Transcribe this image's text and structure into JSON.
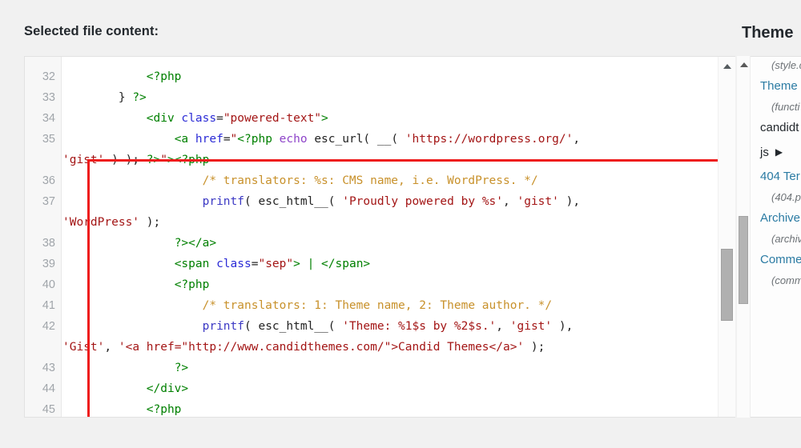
{
  "header": {
    "label": "Selected file content:"
  },
  "theme_panel": {
    "title": "Theme",
    "items": [
      {
        "type": "sub",
        "text": "(style.c"
      },
      {
        "type": "link",
        "text": "Theme "
      },
      {
        "type": "sub",
        "text": "(functi"
      },
      {
        "type": "plain",
        "text": "candidt"
      },
      {
        "type": "folder",
        "text": "js",
        "caret": "▶"
      },
      {
        "type": "link",
        "text": "404 Ter"
      },
      {
        "type": "sub",
        "text": "(404.p"
      },
      {
        "type": "link",
        "text": "Archive"
      },
      {
        "type": "sub",
        "text": "(archiv"
      },
      {
        "type": "link",
        "text": "Comme"
      },
      {
        "type": "sub",
        "text": "(comm"
      }
    ],
    "scrollbar": {
      "up_arrow_icon": "triangle-up-icon",
      "thumb_name": "theme-panel-scroll-thumb"
    }
  },
  "editor": {
    "scrollbar": {
      "up_arrow_icon": "triangle-up-icon",
      "thumb_name": "editor-scroll-thumb"
    },
    "annotation": {
      "color": "#ee1c1c",
      "shape": "rectangle",
      "covers_lines": "34-44"
    },
    "lines": [
      {
        "no": "32",
        "tokens": [
          {
            "c": "t-plain",
            "t": "            "
          },
          {
            "c": "t-tag",
            "t": "<?php"
          }
        ]
      },
      {
        "no": "33",
        "tokens": [
          {
            "c": "t-plain",
            "t": "        } "
          },
          {
            "c": "t-tag",
            "t": "?>"
          }
        ]
      },
      {
        "no": "34",
        "tokens": [
          {
            "c": "t-plain",
            "t": "            "
          },
          {
            "c": "t-tag",
            "t": "<div "
          },
          {
            "c": "t-attr",
            "t": "class"
          },
          {
            "c": "t-plain",
            "t": "="
          },
          {
            "c": "t-str",
            "t": "\"powered-text\""
          },
          {
            "c": "t-tag",
            "t": ">"
          }
        ]
      },
      {
        "no": "35",
        "tokens": [
          {
            "c": "t-plain",
            "t": "                "
          },
          {
            "c": "t-tag",
            "t": "<a "
          },
          {
            "c": "t-attr",
            "t": "href"
          },
          {
            "c": "t-plain",
            "t": "="
          },
          {
            "c": "t-str",
            "t": "\""
          },
          {
            "c": "t-tag",
            "t": "<?php "
          },
          {
            "c": "t-kw",
            "t": "echo "
          },
          {
            "c": "t-plain",
            "t": "esc_url( __( "
          },
          {
            "c": "t-str",
            "t": "'https://wordpress.org/'"
          },
          {
            "c": "t-plain",
            "t": ","
          }
        ]
      },
      {
        "no": "",
        "wrap": true,
        "tokens": [
          {
            "c": "t-str",
            "t": "'gist'"
          },
          {
            "c": "t-plain",
            "t": " ) ); "
          },
          {
            "c": "t-tag",
            "t": "?>"
          },
          {
            "c": "t-str",
            "t": "\""
          },
          {
            "c": "t-tag",
            "t": "><?php"
          }
        ]
      },
      {
        "no": "36",
        "tokens": [
          {
            "c": "t-plain",
            "t": "                    "
          },
          {
            "c": "t-cmt",
            "t": "/* translators: %s: CMS name, i.e. WordPress. */"
          }
        ]
      },
      {
        "no": "37",
        "tokens": [
          {
            "c": "t-plain",
            "t": "                    "
          },
          {
            "c": "t-fn",
            "t": "printf"
          },
          {
            "c": "t-plain",
            "t": "( esc_html__( "
          },
          {
            "c": "t-str",
            "t": "'Proudly powered by %s'"
          },
          {
            "c": "t-plain",
            "t": ", "
          },
          {
            "c": "t-str",
            "t": "'gist'"
          },
          {
            "c": "t-plain",
            "t": " ),"
          }
        ]
      },
      {
        "no": "",
        "wrap": true,
        "tokens": [
          {
            "c": "t-str",
            "t": "'WordPress'"
          },
          {
            "c": "t-plain",
            "t": " );"
          }
        ]
      },
      {
        "no": "38",
        "tokens": [
          {
            "c": "t-plain",
            "t": "                "
          },
          {
            "c": "t-tag",
            "t": "?></a>"
          }
        ]
      },
      {
        "no": "39",
        "tokens": [
          {
            "c": "t-plain",
            "t": "                "
          },
          {
            "c": "t-tag",
            "t": "<span "
          },
          {
            "c": "t-attr",
            "t": "class"
          },
          {
            "c": "t-plain",
            "t": "="
          },
          {
            "c": "t-str",
            "t": "\"sep\""
          },
          {
            "c": "t-tag",
            "t": "> | </span>"
          }
        ]
      },
      {
        "no": "40",
        "tokens": [
          {
            "c": "t-plain",
            "t": "                "
          },
          {
            "c": "t-tag",
            "t": "<?php"
          }
        ]
      },
      {
        "no": "41",
        "tokens": [
          {
            "c": "t-plain",
            "t": "                    "
          },
          {
            "c": "t-cmt",
            "t": "/* translators: 1: Theme name, 2: Theme author. */"
          }
        ]
      },
      {
        "no": "42",
        "tokens": [
          {
            "c": "t-plain",
            "t": "                    "
          },
          {
            "c": "t-fn",
            "t": "printf"
          },
          {
            "c": "t-plain",
            "t": "( esc_html__( "
          },
          {
            "c": "t-str",
            "t": "'Theme: %1$s by %2$s.'"
          },
          {
            "c": "t-plain",
            "t": ", "
          },
          {
            "c": "t-str",
            "t": "'gist'"
          },
          {
            "c": "t-plain",
            "t": " ),"
          }
        ]
      },
      {
        "no": "",
        "wrap": true,
        "tokens": [
          {
            "c": "t-str",
            "t": "'Gist'"
          },
          {
            "c": "t-plain",
            "t": ", "
          },
          {
            "c": "t-str",
            "t": "'<a href=\"http://www.candidthemes.com/\">Candid Themes</a>'"
          },
          {
            "c": "t-plain",
            "t": " );"
          }
        ]
      },
      {
        "no": "43",
        "tokens": [
          {
            "c": "t-plain",
            "t": "                "
          },
          {
            "c": "t-tag",
            "t": "?>"
          }
        ]
      },
      {
        "no": "44",
        "tokens": [
          {
            "c": "t-plain",
            "t": "            "
          },
          {
            "c": "t-tag",
            "t": "</div>"
          }
        ]
      },
      {
        "no": "45",
        "tokens": [
          {
            "c": "t-plain",
            "t": "            "
          },
          {
            "c": "t-tag",
            "t": "<?php"
          }
        ]
      }
    ]
  }
}
